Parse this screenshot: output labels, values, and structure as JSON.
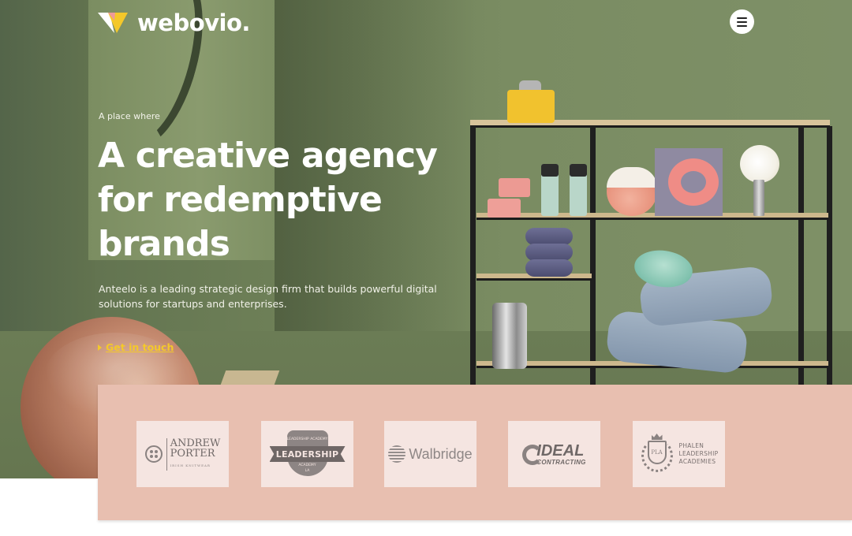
{
  "brand": {
    "name": "webovio.",
    "colors": {
      "mark_yellow": "#f4c82a",
      "mark_pink": "#ee9a9a",
      "accent": "#f4c82a"
    }
  },
  "header": {
    "menu_icon": "hamburger-icon"
  },
  "hero": {
    "eyebrow": "A place where",
    "headline": "A creative agency for redemptive brands",
    "description": "Anteelo is a leading strategic design firm that builds powerful digital solutions for startups and enterprises.",
    "cta_label": "Get in touch"
  },
  "clients": {
    "background": "#e8bfb0",
    "logos": [
      {
        "name": "Andrew Porter",
        "line1": "ANDREW",
        "line2": "PORTER",
        "tagline": "IRISH KNITWEAR"
      },
      {
        "name": "Leadership Academy",
        "top": "LEADERSHIP ACADEMY",
        "banner": "LEADERSHIP",
        "bottom": "ACADEMY",
        "badge": "LA"
      },
      {
        "name": "Walbridge",
        "word": "Walbridge"
      },
      {
        "name": "Ideal Contracting",
        "line1": "IDEAL",
        "line2": "CONTRACTING"
      },
      {
        "name": "Phalen Leadership Academies",
        "monogram": "PLA",
        "line1": "PHALEN",
        "line2": "LEADERSHIP",
        "line3": "ACADEMIES"
      }
    ]
  }
}
